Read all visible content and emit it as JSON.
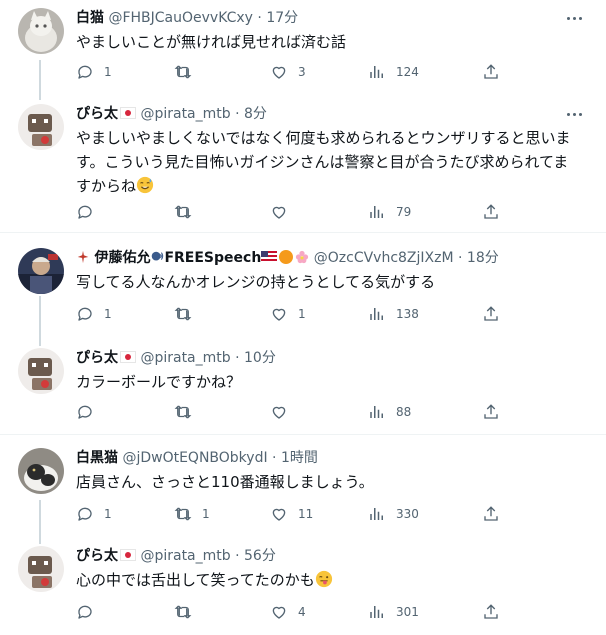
{
  "tweets": [
    {
      "name": "白猫",
      "handle": "@FHBJCauOevvKCxy",
      "dot": "·",
      "time": "17分",
      "text": "やましいことが無ければ見せれば済む話",
      "replies": "1",
      "retweets": "",
      "likes": "3",
      "views": "124"
    },
    {
      "name": "ぴら太",
      "handle": "@pirata_mtb",
      "dot": "·",
      "time": "8分",
      "text_line1": "やましいやましくないではなく何度も求められるとウンザリすると思いま",
      "text_line2": "す。こういう見た目怖いガイジンさんは警察と目が合うたび求められてま",
      "text_line3": "すからね",
      "replies": "",
      "retweets": "",
      "likes": "",
      "views": "79"
    },
    {
      "name_prefix": "伊藤佑允",
      "name_suffix": "FREESpeech",
      "handle": "@OzcCVvhc8ZjIXzM",
      "dot": "·",
      "time": "18分",
      "text": "写してる人なんかオレンジの持とうとしてる気がする",
      "replies": "1",
      "retweets": "",
      "likes": "1",
      "views": "138"
    },
    {
      "name": "ぴら太",
      "handle": "@pirata_mtb",
      "dot": "·",
      "time": "10分",
      "text": "カラーボールですかね？",
      "replies": "",
      "retweets": "",
      "likes": "",
      "views": "88"
    },
    {
      "name": "白黒猫",
      "handle": "@jDwOtEQNBObkydI",
      "dot": "·",
      "time": "1時間",
      "text": "店員さん、さっさと110番通報しましょう。",
      "replies": "1",
      "retweets": "1",
      "likes": "11",
      "views": "330"
    },
    {
      "name": "ぴら太",
      "handle": "@pirata_mtb",
      "dot": "·",
      "time": "56分",
      "text": "心の中では舌出して笑ってたのかも",
      "replies": "",
      "retweets": "",
      "likes": "4",
      "views": "301"
    }
  ],
  "icons": {
    "reply": "reply-icon",
    "retweet": "retweet-icon",
    "like": "like-icon",
    "views": "views-icon",
    "share": "share-icon",
    "more": "more-icon"
  },
  "colors": {
    "text": "#0f1419",
    "secondary": "#536471",
    "line": "#cfd9de",
    "divider": "#eff3f4"
  }
}
